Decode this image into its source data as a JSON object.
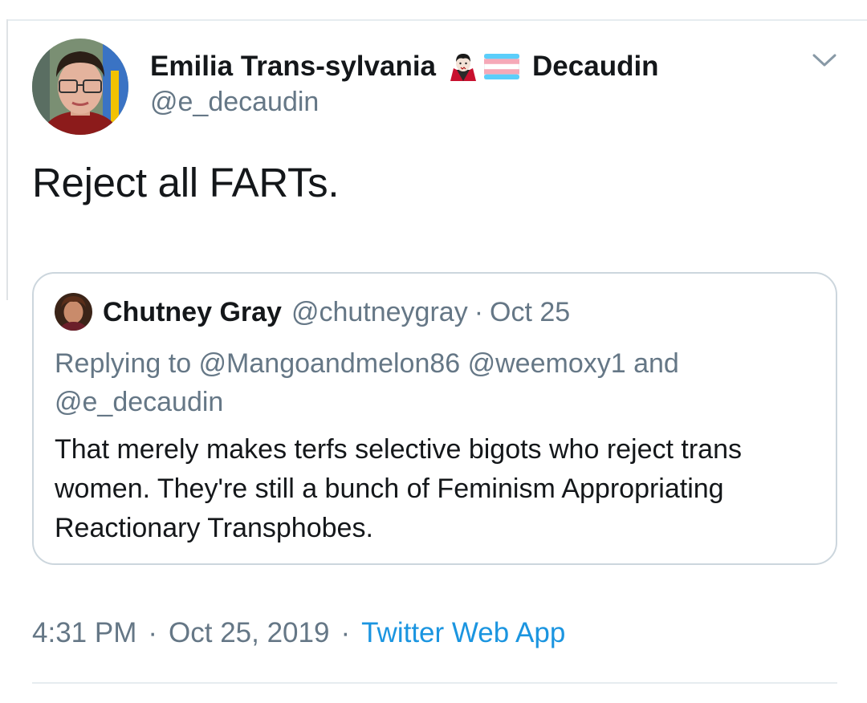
{
  "tweet": {
    "author": {
      "name_first": "Emilia Trans-sylvania",
      "name_last": "Decaudin",
      "handle": "@e_decaudin",
      "emojis": [
        "vampire-icon",
        "transgender-flag-icon"
      ]
    },
    "text": "Reject all FARTs.",
    "quoted": {
      "author_name": "Chutney Gray",
      "author_handle": "@chutneygray",
      "separator": "·",
      "date": "Oct 25",
      "replying_to": "Replying to @Mangoandmelon86 @weemoxy1 and @e_decaudin",
      "text": "That merely makes terfs selective bigots who reject trans women. They're still a bunch of Feminism Appropriating Reactionary Transphobes."
    },
    "meta": {
      "time": "4:31 PM",
      "separator": "·",
      "date": "Oct 25, 2019",
      "separator2": "·",
      "source": "Twitter Web App"
    }
  },
  "colors": {
    "primary_text": "#14171a",
    "secondary_text": "#657786",
    "link": "#1b95e0",
    "border": "#ccd6dd",
    "flag_blue": "#5bcefa",
    "flag_pink": "#f5a9b8",
    "flag_white": "#ffffff"
  }
}
